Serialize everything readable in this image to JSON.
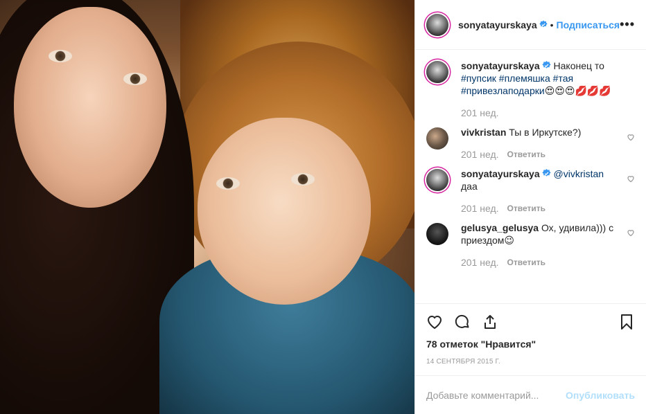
{
  "header": {
    "username": "sonyatayurskaya",
    "dot": "•",
    "follow_label": "Подписаться",
    "more": "•••"
  },
  "caption": {
    "username": "sonyatayurskaya",
    "text_lead": "Наконец то",
    "hashtags": [
      "#пупсик",
      "#племяшка",
      "#тая",
      "#привезлаподарки"
    ],
    "emoji": "😍😍😍💋💋💋",
    "time": "201 нед."
  },
  "comments": [
    {
      "username": "vivkristan",
      "text": "Ты в Иркутске?)",
      "time": "201 нед.",
      "reply": "Ответить"
    },
    {
      "username": "sonyatayurskaya",
      "mention": "@vivkristan",
      "text": "даа",
      "time": "201 нед.",
      "reply": "Ответить"
    },
    {
      "username": "gelusya_gelusya",
      "text": "Ох, удивила))) с приездом😉",
      "time": "201 нед.",
      "reply": "Ответить"
    }
  ],
  "likes": "78 отметок \"Нравится\"",
  "date": "14 сентября 2015 г.",
  "add_comment": {
    "placeholder": "Добавьте комментарий...",
    "post_label": "Опубликовать"
  },
  "colors": {
    "accent": "#3897f0",
    "verified": "#3897f0",
    "hashtag": "#003569"
  }
}
